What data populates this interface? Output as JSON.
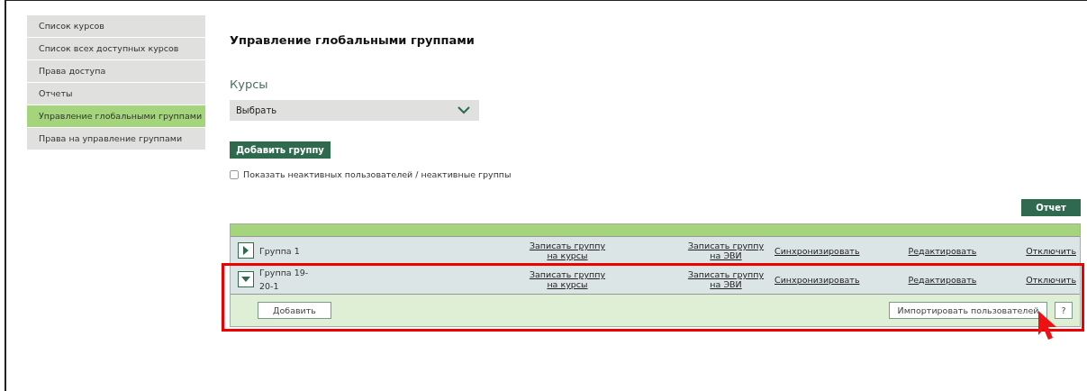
{
  "sidebar": {
    "items": [
      {
        "label": "Список курсов",
        "selected": false
      },
      {
        "label": "Список всех доступных курсов",
        "selected": false
      },
      {
        "label": "Права доступа",
        "selected": false
      },
      {
        "label": "Отчеты",
        "selected": false
      },
      {
        "label": "Управление глобальными группами",
        "selected": true
      },
      {
        "label": "Права на управление группами",
        "selected": false
      }
    ]
  },
  "title": "Управление глобальными группами",
  "courses": {
    "label": "Курсы",
    "select_value": "Выбрать"
  },
  "add_group_button": "Добавить группу",
  "inactive_checkbox": {
    "label": "Показать неактивных пользователей / неактивные группы",
    "checked": false
  },
  "report_button": "Отчет",
  "groups": [
    {
      "name": "Группа 1",
      "expanded": false,
      "actions": [
        "Записать группу\nна курсы",
        "Записать группу\nна ЭВИ",
        "Синхронизировать",
        "Редактировать",
        "Отключить"
      ]
    },
    {
      "name": "Группа 19-\n20-1",
      "expanded": true,
      "actions": [
        "Записать группу\nна курсы",
        "Записать группу\nна ЭВИ",
        "Синхронизировать",
        "Редактировать",
        "Отключить"
      ],
      "panel": {
        "add_button": "Добавить",
        "import_button": "Импортировать пользователей",
        "help_button": "?"
      }
    }
  ]
}
